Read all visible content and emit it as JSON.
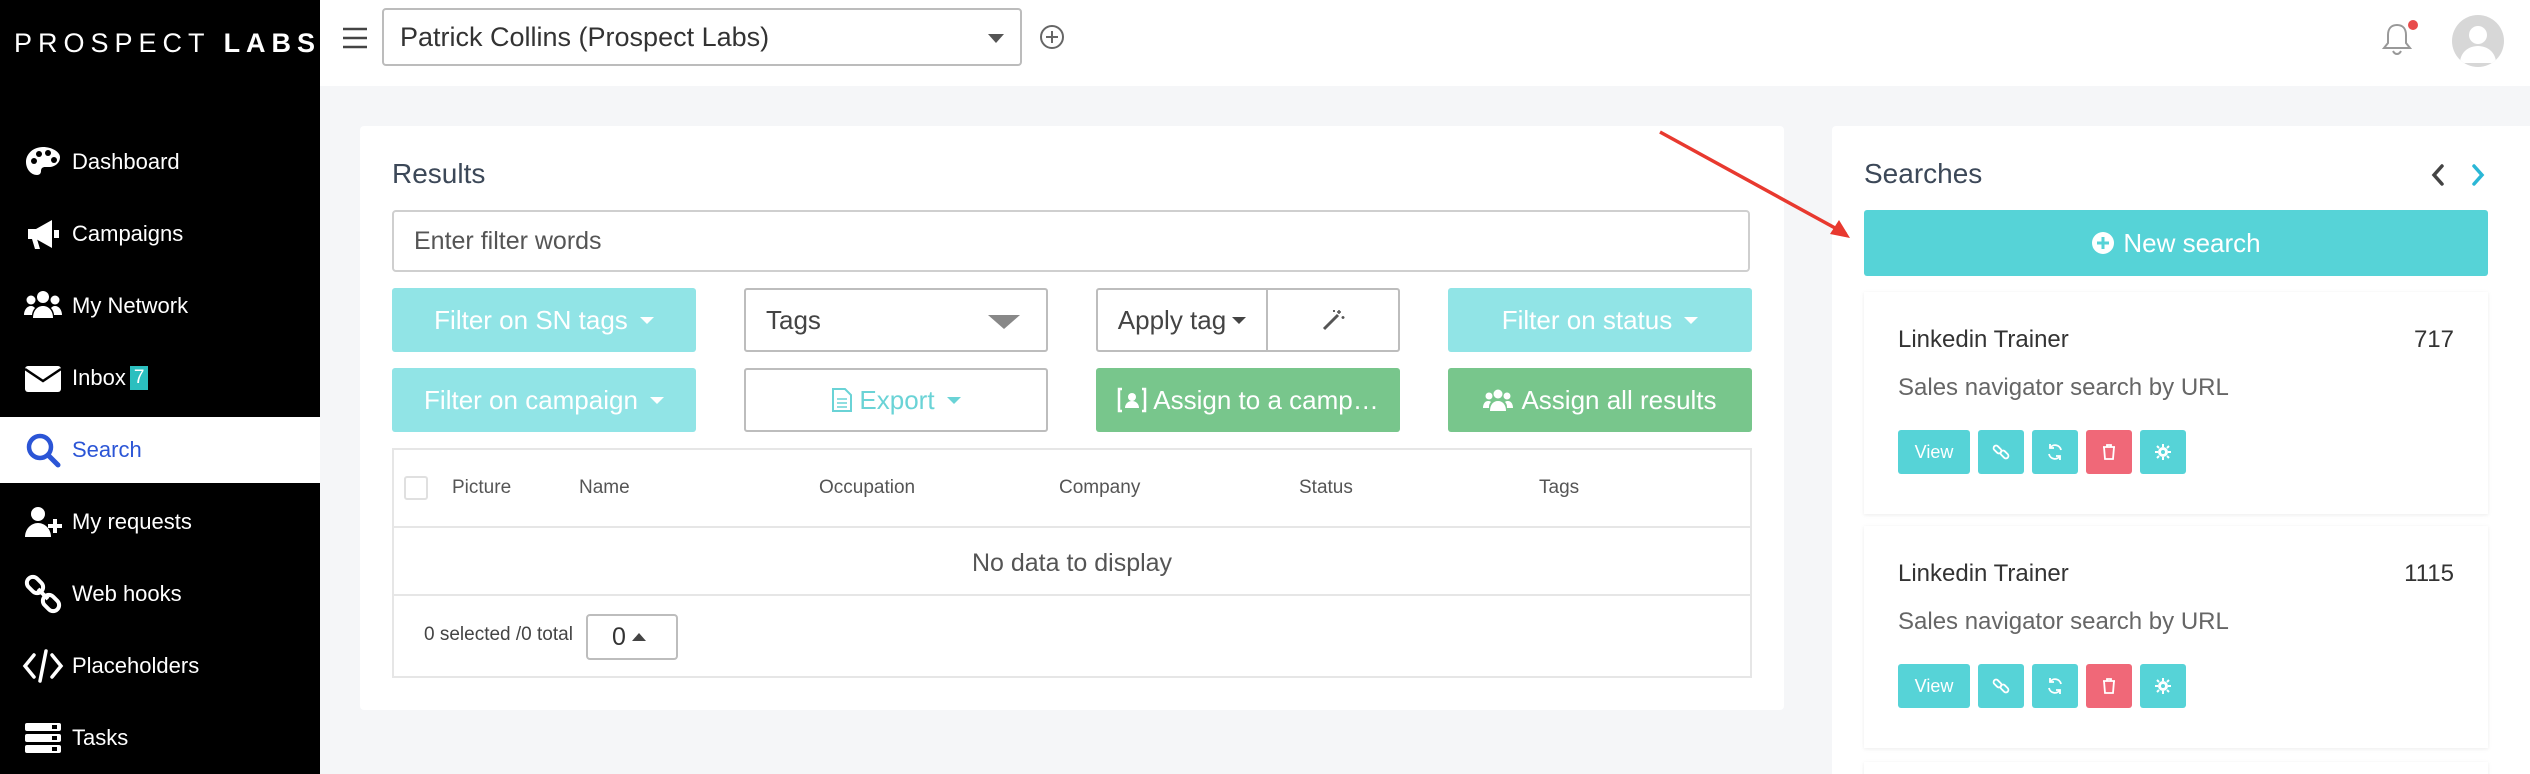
{
  "sidebar": {
    "logo_light": "PROSPECT",
    "logo_bold": "LABS",
    "items": [
      {
        "label": "Dashboard",
        "icon": "palette-icon"
      },
      {
        "label": "Campaigns",
        "icon": "megaphone-icon"
      },
      {
        "label": "My Network",
        "icon": "users-icon"
      },
      {
        "label": "Inbox",
        "icon": "envelope-icon",
        "badge": "7"
      },
      {
        "label": "Search",
        "icon": "search-icon",
        "active": true
      },
      {
        "label": "My requests",
        "icon": "user-plus-icon"
      },
      {
        "label": "Web hooks",
        "icon": "link-icon"
      },
      {
        "label": "Placeholders",
        "icon": "code-icon"
      },
      {
        "label": "Tasks",
        "icon": "tasks-icon"
      }
    ]
  },
  "topbar": {
    "account": "Patrick Collins (Prospect Labs)"
  },
  "results": {
    "title": "Results",
    "filter_placeholder": "Enter filter words",
    "filter_sn_tags": "Filter on SN tags",
    "tags_select": "Tags",
    "apply_tag": "Apply tag",
    "filter_status": "Filter on status",
    "filter_campaign": "Filter on campaign",
    "export": "Export",
    "assign_campaign": "Assign to a camp…",
    "assign_all": "Assign all results",
    "columns": [
      "Picture",
      "Name",
      "Occupation",
      "Company",
      "Status",
      "Tags"
    ],
    "no_data": "No data to display",
    "selected_text": "0 selected /0 total",
    "page_size": "0"
  },
  "searches": {
    "title": "Searches",
    "new_search": "New search",
    "items": [
      {
        "name": "Linkedin Trainer",
        "count": "717",
        "type": "Sales navigator search by URL",
        "view": "View"
      },
      {
        "name": "Linkedin Trainer",
        "count": "1115",
        "type": "Sales navigator search by URL",
        "view": "View"
      }
    ]
  },
  "colors": {
    "accent_teal": "#56d3d7",
    "teal_light": "#91e4e6",
    "green": "#78c68c",
    "danger": "#f06878",
    "active_nav": "#2b55d6",
    "annotation_arrow": "#e8392f"
  }
}
